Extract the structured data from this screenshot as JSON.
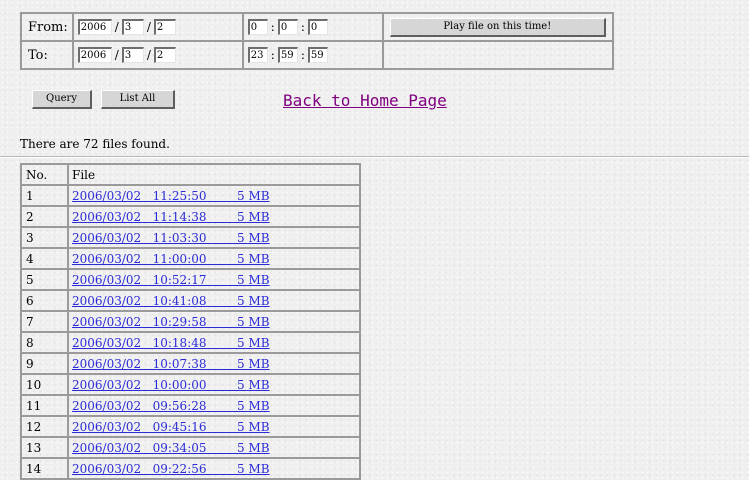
{
  "range": {
    "from_label": "From:",
    "to_label": "To:",
    "from": {
      "year": "2006",
      "month": "3",
      "day": "2",
      "hour": "0",
      "minute": "0",
      "second": "0"
    },
    "to": {
      "year": "2006",
      "month": "3",
      "day": "2",
      "hour": "23",
      "minute": "59",
      "second": "59"
    },
    "date_sep": "/",
    "time_sep": ":",
    "play_button": "Play file on this time!"
  },
  "actions": {
    "query_button": "Query",
    "list_all_button": "List All",
    "home_link": "Back to Home Page"
  },
  "result_text": "There are 72 files found.",
  "table": {
    "headers": [
      "No.",
      "File"
    ],
    "rows": [
      {
        "no": "1",
        "file": "2006/03/02   11:25:50        5 MB"
      },
      {
        "no": "2",
        "file": "2006/03/02   11:14:38        5 MB"
      },
      {
        "no": "3",
        "file": "2006/03/02   11:03:30        5 MB"
      },
      {
        "no": "4",
        "file": "2006/03/02   11:00:00        5 MB"
      },
      {
        "no": "5",
        "file": "2006/03/02   10:52:17        5 MB"
      },
      {
        "no": "6",
        "file": "2006/03/02   10:41:08        5 MB"
      },
      {
        "no": "7",
        "file": "2006/03/02   10:29:58        5 MB"
      },
      {
        "no": "8",
        "file": "2006/03/02   10:18:48        5 MB"
      },
      {
        "no": "9",
        "file": "2006/03/02   10:07:38        5 MB"
      },
      {
        "no": "10",
        "file": "2006/03/02   10:00:00        5 MB"
      },
      {
        "no": "11",
        "file": "2006/03/02   09:56:28        5 MB"
      },
      {
        "no": "12",
        "file": "2006/03/02   09:45:16        5 MB"
      },
      {
        "no": "13",
        "file": "2006/03/02   09:34:05        5 MB"
      },
      {
        "no": "14",
        "file": "2006/03/02   09:22:56        5 MB"
      }
    ]
  }
}
